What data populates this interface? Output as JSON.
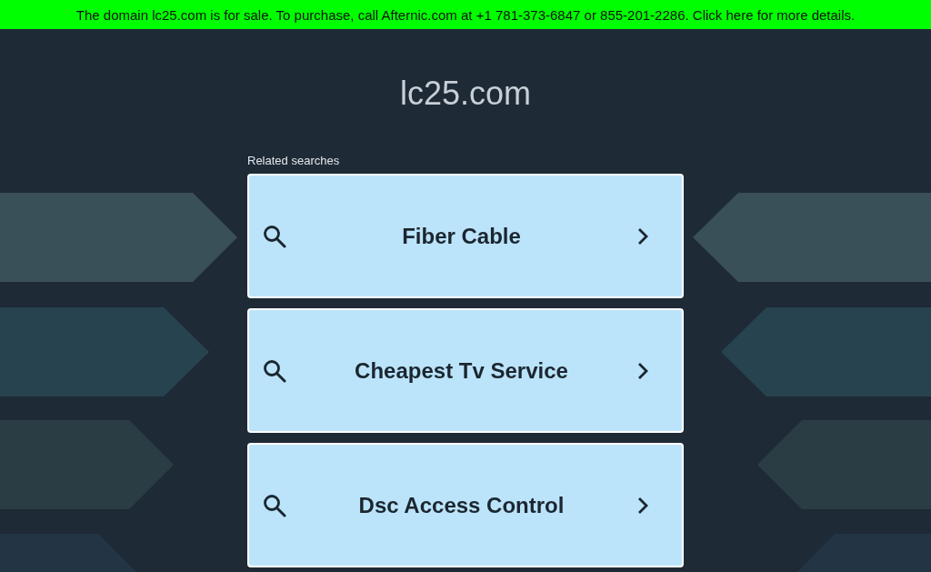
{
  "banner": {
    "text": "The domain lc25.com is for sale. To purchase, call Afternic.com at +1 781-373-6847 or 855-201-2286. Click here for more details."
  },
  "site_title": "lc25.com",
  "related": {
    "heading": "Related searches",
    "items": [
      {
        "label": "Fiber Cable"
      },
      {
        "label": "Cheapest Tv Service"
      },
      {
        "label": "Dsc Access Control"
      }
    ]
  }
}
